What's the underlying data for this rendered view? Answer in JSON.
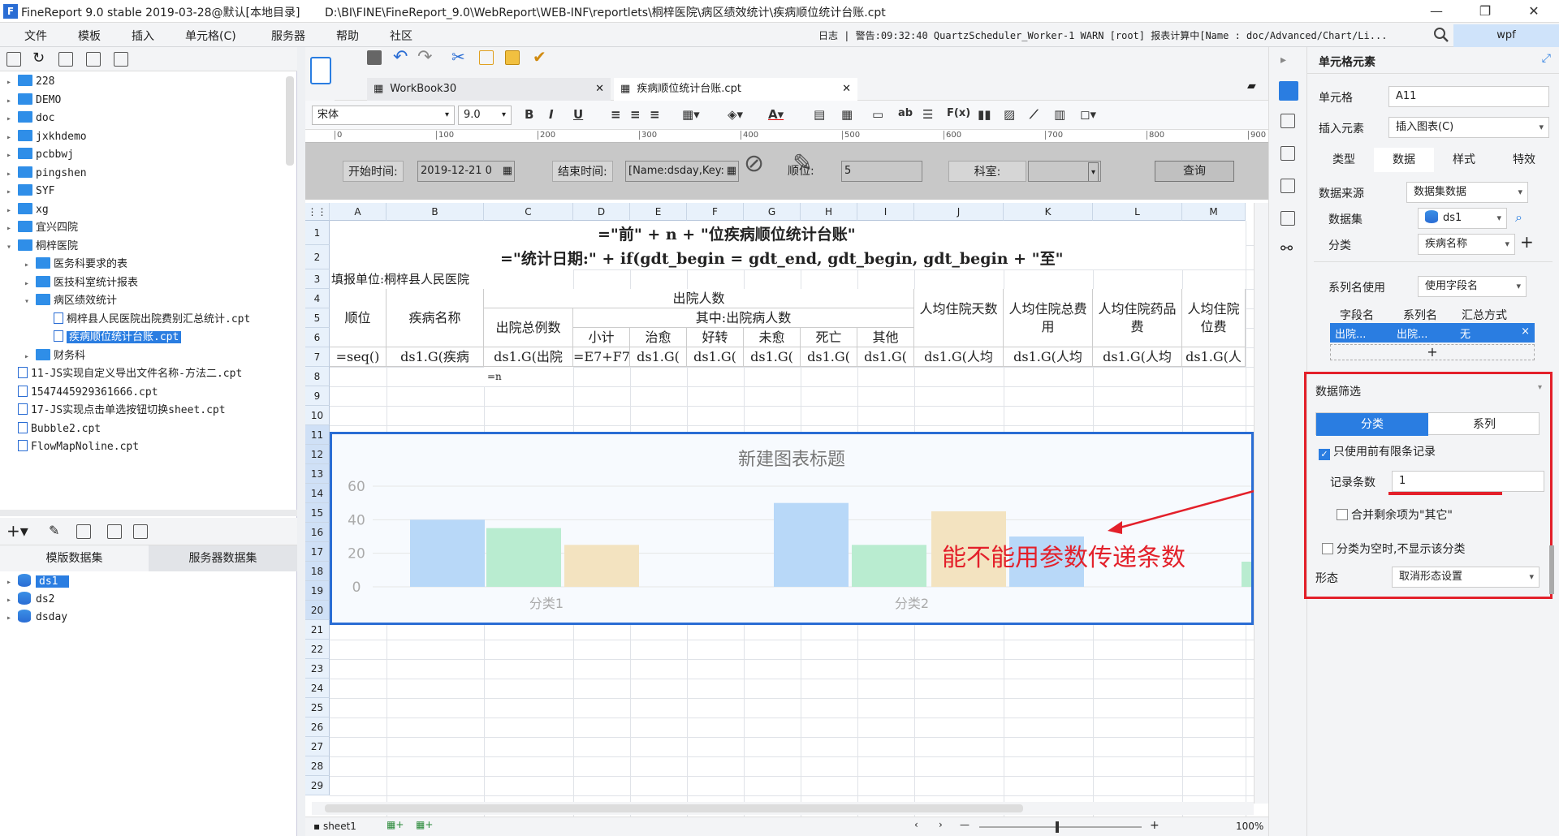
{
  "app": {
    "title": "FineReport 9.0 stable 2019-03-28@默认[本地目录]",
    "path": "D:\\BI\\FINE\\FineReport_9.0\\WebReport\\WEB-INF\\reportlets\\桐梓医院\\病区绩效统计\\疾病顺位统计台账.cpt",
    "logo": "F"
  },
  "menu": [
    "文件",
    "模板",
    "插入",
    "单元格(C)",
    "服务器",
    "帮助",
    "社区"
  ],
  "log": "日志 | 警告:09:32:40 QuartzScheduler_Worker-1 WARN [root] 报表计算中[Name : doc/Advanced/Chart/Li...",
  "wpf": "wpf",
  "tree": [
    {
      "label": "228",
      "type": "folder",
      "indent": 0,
      "arrow": "▸"
    },
    {
      "label": "DEMO",
      "type": "folder",
      "indent": 0,
      "arrow": "▸"
    },
    {
      "label": "doc",
      "type": "folder",
      "indent": 0,
      "arrow": "▸"
    },
    {
      "label": "jxkhdemo",
      "type": "folder",
      "indent": 0,
      "arrow": "▸"
    },
    {
      "label": "pcbbwj",
      "type": "folder",
      "indent": 0,
      "arrow": "▸"
    },
    {
      "label": "pingshen",
      "type": "folder",
      "indent": 0,
      "arrow": "▸"
    },
    {
      "label": "SYF",
      "type": "folder",
      "indent": 0,
      "arrow": "▸"
    },
    {
      "label": "xg",
      "type": "folder",
      "indent": 0,
      "arrow": "▸"
    },
    {
      "label": "宜兴四院",
      "type": "folder",
      "indent": 0,
      "arrow": "▸"
    },
    {
      "label": "桐梓医院",
      "type": "folder",
      "indent": 0,
      "arrow": "▾"
    },
    {
      "label": "医务科要求的表",
      "type": "folder",
      "indent": 1,
      "arrow": "▸"
    },
    {
      "label": "医技科室统计报表",
      "type": "folder",
      "indent": 1,
      "arrow": "▸"
    },
    {
      "label": "病区绩效统计",
      "type": "folder",
      "indent": 1,
      "arrow": "▾"
    },
    {
      "label": "桐梓县人民医院出院费别汇总统计.cpt",
      "type": "file",
      "indent": 2,
      "arrow": ""
    },
    {
      "label": "疾病顺位统计台账.cpt",
      "type": "file",
      "indent": 2,
      "arrow": "",
      "selected": true
    },
    {
      "label": "财务科",
      "type": "folder",
      "indent": 1,
      "arrow": "▸"
    },
    {
      "label": "11-JS实现自定义导出文件名称-方法二.cpt",
      "type": "file",
      "indent": 0,
      "arrow": ""
    },
    {
      "label": "1547445929361666.cpt",
      "type": "file",
      "indent": 0,
      "arrow": ""
    },
    {
      "label": "17-JS实现点击单选按钮切换sheet.cpt",
      "type": "file",
      "indent": 0,
      "arrow": ""
    },
    {
      "label": "Bubble2.cpt",
      "type": "file",
      "indent": 0,
      "arrow": ""
    },
    {
      "label": "FlowMapNoline.cpt",
      "type": "file",
      "indent": 0,
      "arrow": ""
    }
  ],
  "dataset_tabs": [
    "模版数据集",
    "服务器数据集"
  ],
  "datasets": [
    "ds1",
    "ds2",
    "dsday"
  ],
  "doc_tabs": [
    "WorkBook30",
    "疾病顺位统计台账.cpt"
  ],
  "format": {
    "font": "宋体",
    "size": "9.0"
  },
  "ruler": [
    "0",
    "100",
    "200",
    "300",
    "400",
    "500",
    "600",
    "700",
    "800",
    "900"
  ],
  "params": {
    "start_label": "开始时间:",
    "start_value": "2019-12-21 0",
    "end_label": "结束时间:",
    "end_value": "[Name:dsday,Key:",
    "rank_label": "顺位:",
    "rank_value": "5",
    "dept_label": "科室:",
    "query": "查询"
  },
  "columns": [
    "A",
    "B",
    "C",
    "D",
    "E",
    "F",
    "G",
    "H",
    "I",
    "J",
    "K",
    "L",
    "M"
  ],
  "rows": [
    "1",
    "2",
    "3",
    "4",
    "5",
    "6",
    "7",
    "8",
    "9",
    "10",
    "11",
    "12",
    "13",
    "14",
    "15",
    "16",
    "17",
    "18",
    "19",
    "20",
    "21",
    "22",
    "23",
    "24",
    "25",
    "26",
    "27",
    "28",
    "29"
  ],
  "cells": {
    "r1": "=\"前\" + n + \"位疾病顺位统计台账\"",
    "r2": "=\"统计日期:\" + if(gdt_begin = gdt_end, gdt_begin, gdt_begin + \"至\"",
    "r3": "填报单位:桐梓县人民医院",
    "h_out": "出院人数",
    "h_of": "其中:出院病人数",
    "h_rank": "顺位",
    "h_name": "疾病名称",
    "h_total": "出院总例数",
    "h_sub": [
      "小计",
      "治愈",
      "好转",
      "未愈",
      "死亡",
      "其他"
    ],
    "h_days": "人均住院天数",
    "h_cost": "人均住院总费用",
    "h_drug": "人均住院药品费",
    "h_bed": "人均住院位费",
    "r7": [
      "=seq()",
      "ds1.G(疾病",
      "ds1.G(出院",
      "=E7+F7",
      "ds1.G(",
      "ds1.G(",
      "ds1.G(",
      "ds1.G(",
      "ds1.G(",
      "ds1.G(人均",
      "ds1.G(人均",
      "ds1.G(人均",
      "ds1.G(人"
    ],
    "r8c": "=n"
  },
  "chart_data": {
    "type": "bar",
    "title": "新建图表标题",
    "categories": [
      "分类1",
      "分类2"
    ],
    "series": [
      {
        "values": [
          40,
          35,
          25
        ]
      },
      {
        "values": [
          50,
          25,
          45,
          30
        ]
      }
    ],
    "ylim": [
      0,
      60
    ],
    "yticks": [
      "0",
      "20",
      "40",
      "60"
    ],
    "colors": [
      "#b8d8f8",
      "#b9ecd0",
      "#f3e3c0"
    ]
  },
  "annotation": "能不能用参数传递条数",
  "bottom": {
    "sheet": "sheet1",
    "zoom": "100%"
  },
  "right": {
    "header": "单元格元素",
    "cell_label": "单元格",
    "cell_value": "A11",
    "insert_label": "插入元素",
    "insert_value": "插入图表(C)",
    "tabs": [
      "类型",
      "数据",
      "样式",
      "特效"
    ],
    "source_label": "数据来源",
    "source_value": "数据集数据",
    "dataset_label": "数据集",
    "dataset_value": "ds1",
    "category_label": "分类",
    "category_value": "疾病名称",
    "seriesname_label": "系列名使用",
    "seriesname_value": "使用字段名",
    "table_headers": [
      "字段名",
      "系列名",
      "汇总方式"
    ],
    "table_row": [
      "出院...",
      "出院...",
      "无"
    ],
    "filter_title": "数据筛选",
    "filter_tabs": [
      "分类",
      "系列"
    ],
    "only_top": "只使用前有限条记录",
    "count_label": "记录条数",
    "count_value": "1",
    "merge_other": "合并剩余项为\"其它\"",
    "hide_empty": "分类为空时,不显示该分类",
    "form_label": "形态",
    "form_value": "取消形态设置"
  }
}
